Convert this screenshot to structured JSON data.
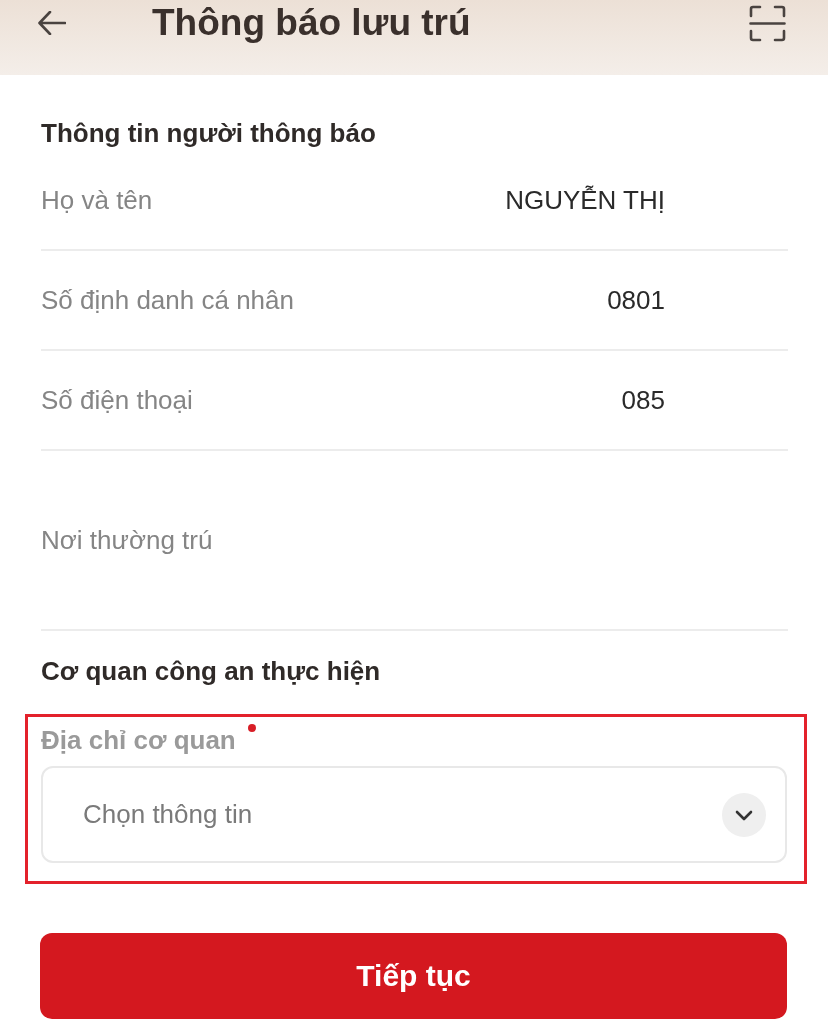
{
  "header": {
    "title": "Thông báo lưu trú"
  },
  "notifier": {
    "heading": "Thông tin người thông báo",
    "rows": [
      {
        "kind": "single",
        "label": "Họ và tên",
        "value": "NGUYỄN THỊ"
      },
      {
        "kind": "single",
        "label": "Số định danh cá nhân",
        "value": "0801"
      },
      {
        "kind": "single",
        "label": "Số điện thoại",
        "value": "085"
      },
      {
        "kind": "multiline",
        "label": "Nơi thường trú"
      }
    ]
  },
  "agency": {
    "heading": "Cơ quan công an thực hiện",
    "field": {
      "label": "Địa chỉ cơ quan",
      "required": true,
      "placeholder": "Chọn thông tin",
      "highlighted": true
    }
  },
  "button": {
    "label": "Tiếp tục"
  }
}
